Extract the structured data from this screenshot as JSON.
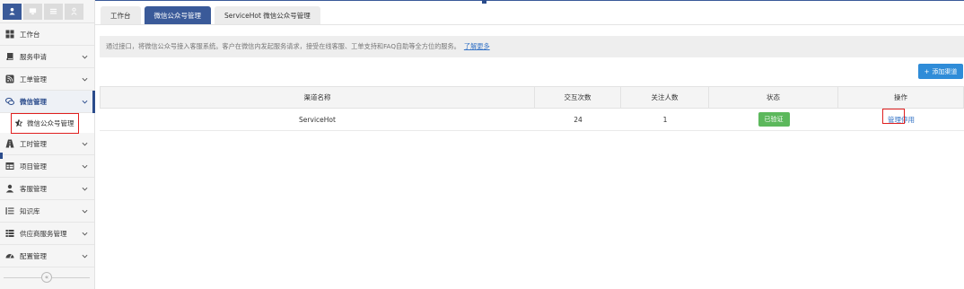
{
  "sidebar": {
    "top_icons": [
      "user-icon",
      "monitor-icon",
      "list-icon",
      "person-icon"
    ],
    "items": [
      {
        "label": "工作台",
        "icon": "windows-icon",
        "has_chevron": false
      },
      {
        "label": "服务申请",
        "icon": "book-icon",
        "has_chevron": true
      },
      {
        "label": "工单管理",
        "icon": "rss-icon",
        "has_chevron": true
      },
      {
        "label": "微信管理",
        "icon": "chat-icon",
        "has_chevron": true,
        "open": true
      },
      {
        "label": "工时管理",
        "icon": "road-icon",
        "has_chevron": true
      },
      {
        "label": "项目管理",
        "icon": "table-icon",
        "has_chevron": true
      },
      {
        "label": "客服管理",
        "icon": "user-icon",
        "has_chevron": true
      },
      {
        "label": "知识库",
        "icon": "list-indent-icon",
        "has_chevron": true
      },
      {
        "label": "供应商服务管理",
        "icon": "th-list-icon",
        "has_chevron": true
      },
      {
        "label": "配置管理",
        "icon": "gauge-icon",
        "has_chevron": true
      }
    ],
    "sub_item": {
      "label": "微信公众号管理",
      "icon": "star-half-icon"
    },
    "collapse_label": "«"
  },
  "tabs": [
    {
      "label": "工作台",
      "active": false
    },
    {
      "label": "微信公众号管理",
      "active": true
    },
    {
      "label": "ServiceHot 微信公众号管理",
      "active": false
    }
  ],
  "notice": {
    "text": "通过接口，将微信公众号接入客服系统。客户在微信内发起服务请求，接受在线客服、工单支持和FAQ自助等全方位的服务。",
    "link": "了解更多"
  },
  "add_button": {
    "label": "添加渠道",
    "icon": "plus-icon"
  },
  "table": {
    "headers": [
      "渠道名称",
      "交互次数",
      "关注人数",
      "状态",
      "操作"
    ],
    "rows": [
      {
        "name": "ServiceHot",
        "interactions": "24",
        "followers": "1",
        "status": "已验证",
        "action_manage": "管理",
        "action_disable": "停用"
      }
    ]
  },
  "colors": {
    "primary": "#3a5a99",
    "accent": "#2f8cd8",
    "success": "#5cb85c",
    "highlight": "#e01f1f",
    "link": "#3573c6"
  }
}
